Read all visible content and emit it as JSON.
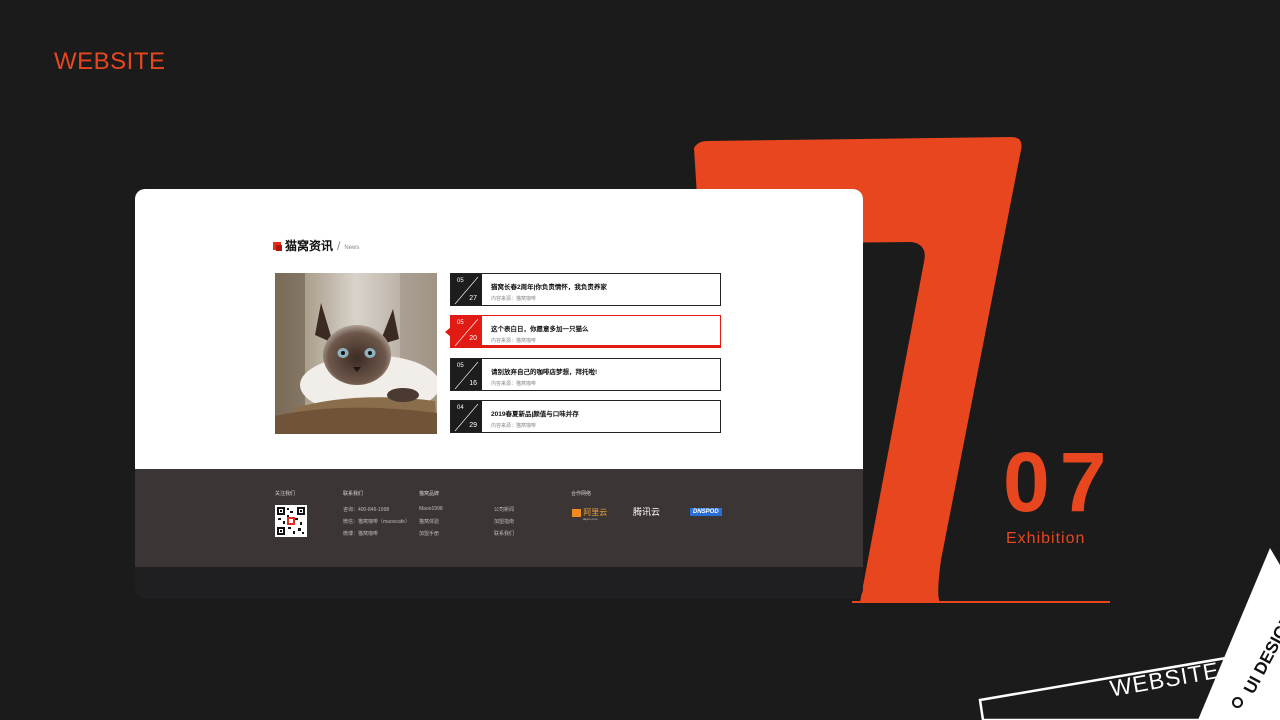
{
  "slide": {
    "brand": "WEBSITE",
    "exhibit_number": "07",
    "exhibit_label": "Exhibition",
    "corner_label": "WEBSITE",
    "corner_tag": "UI DESIGN"
  },
  "colors": {
    "accent": "#e8461f",
    "news_active": "#e11b14",
    "footer_bg": "#3b3536",
    "page_bg": "#1b1b1c"
  },
  "news": {
    "title": "猫窝资讯",
    "slash": "/",
    "subtitle": "News",
    "items": [
      {
        "month": "05",
        "day": "27",
        "title": "猫窝长春2周年|你负责情怀，我负责养家",
        "source": "内容来源：猫窝咖啡",
        "active": false
      },
      {
        "month": "05",
        "day": "20",
        "title": "这个表白日，你愿意多加一只猫么",
        "source": "内容来源：猫窝咖啡",
        "active": true
      },
      {
        "month": "05",
        "day": "16",
        "title": "请别放弃自己的咖啡店梦想，拜托啦!",
        "source": "内容来源：猫窝咖啡",
        "active": false
      },
      {
        "month": "04",
        "day": "29",
        "title": "2019春夏新品|颜值与口味并存",
        "source": "内容来源：猫窝咖啡",
        "active": false
      }
    ]
  },
  "footer": {
    "follow_head": "关注我们",
    "contact_head": "联系我们",
    "contact_lines": [
      "咨询：400-846-1998",
      "微信：猫窝咖啡（maoocafe）",
      "微博：猫窝咖啡"
    ],
    "brand_head": "猫窝品牌",
    "brand_lines": [
      "Maoo1998",
      "猫窝体验",
      "加盟手册"
    ],
    "about_lines": [
      "公司新闻",
      "加盟指南",
      "联系我们"
    ],
    "partner_head": "合作网络",
    "partners": [
      "阿里云",
      "腾讯云",
      "DNSPOD"
    ],
    "partner_sub": "aliyun.com"
  }
}
